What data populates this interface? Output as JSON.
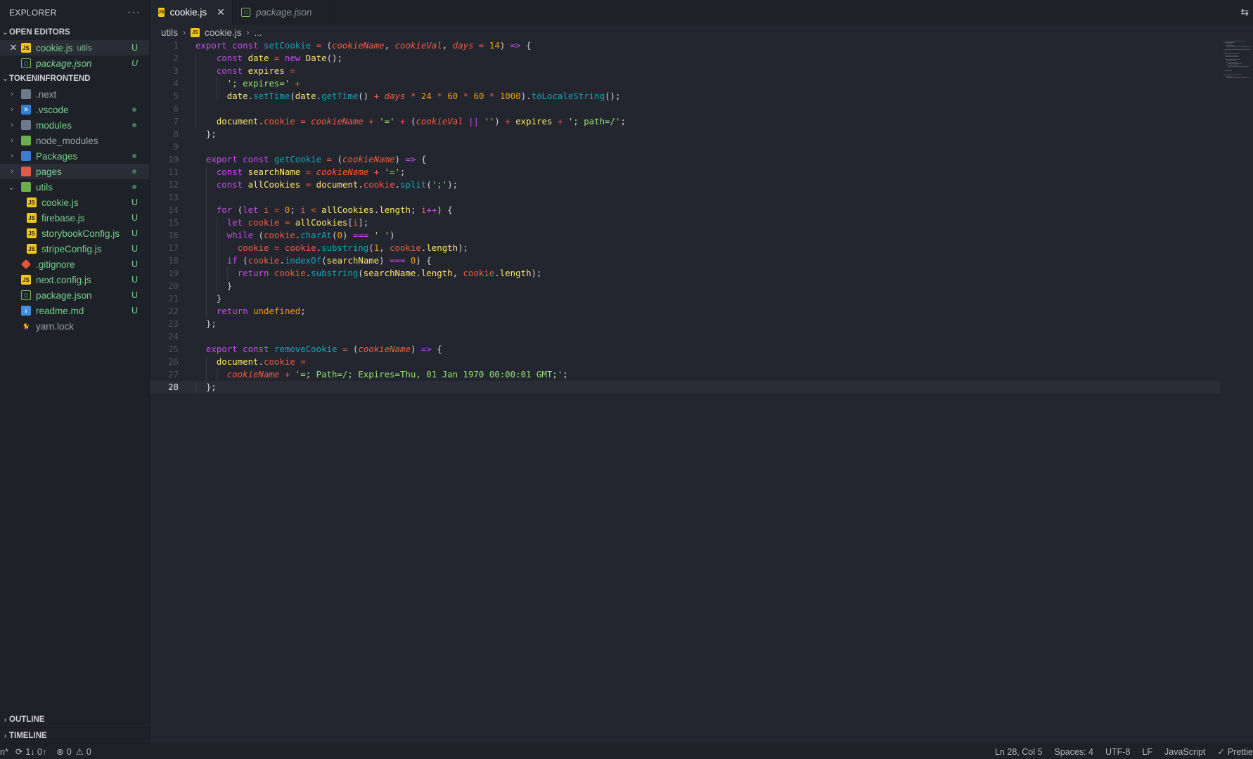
{
  "sidebar": {
    "title": "EXPLORER",
    "more_label": "···",
    "open_editors": {
      "title": "OPEN EDITORS",
      "items": [
        {
          "name": "cookie.js",
          "hint": "utils",
          "status": "U"
        },
        {
          "name": "package.json",
          "status": "U"
        }
      ]
    },
    "project": {
      "title": "TOKENINFRONTEND",
      "items": [
        {
          "name": ".next"
        },
        {
          "name": ".vscode"
        },
        {
          "name": "modules"
        },
        {
          "name": "node_modules"
        },
        {
          "name": "Packages"
        },
        {
          "name": "pages"
        },
        {
          "name": "utils"
        },
        {
          "name": "cookie.js",
          "status": "U"
        },
        {
          "name": "firebase.js",
          "status": "U"
        },
        {
          "name": "storybookConfig.js",
          "status": "U"
        },
        {
          "name": "stripeConfig.js",
          "status": "U"
        },
        {
          "name": ".gitignore",
          "status": "U"
        },
        {
          "name": "next.config.js",
          "status": "U"
        },
        {
          "name": "package.json",
          "status": "U"
        },
        {
          "name": "readme.md",
          "status": "U"
        },
        {
          "name": "yarn.lock"
        }
      ]
    },
    "outline_title": "OUTLINE",
    "timeline_title": "TIMELINE"
  },
  "tabs": [
    {
      "label": "cookie.js",
      "active": true
    },
    {
      "label": "package.json",
      "active": false
    }
  ],
  "breadcrumb": {
    "folder": "utils",
    "file": "cookie.js",
    "more": "..."
  },
  "editor": {
    "line_numbers": [
      "1",
      "2",
      "3",
      "4",
      "5",
      "6",
      "7",
      "8",
      "9",
      "10",
      "11",
      "12",
      "13",
      "14",
      "15",
      "16",
      "17",
      "18",
      "19",
      "20",
      "21",
      "22",
      "23",
      "24",
      "25",
      "26",
      "27",
      "28"
    ],
    "current_line": 28
  },
  "statusbar": {
    "branch": "n*",
    "sync": "1↓ 0↑",
    "errors": "0",
    "warnings": "0",
    "position": "Ln 28, Col 5",
    "spaces": "Spaces: 4",
    "encoding": "UTF-8",
    "eol": "LF",
    "language": "JavaScript",
    "formatter": "Prettie"
  },
  "colors": {
    "background": "#23262e",
    "sidebar": "#1e2128",
    "keyword": "#c74ded",
    "function": "#16a3b6",
    "param": "#ee5d43",
    "string": "#96e072",
    "number": "#f39c12",
    "variable": "#ffe66d",
    "untracked": "#77cf8d"
  },
  "icons": [
    "ellipsis-icon",
    "js-file-icon",
    "npm-package-icon",
    "folder-icon",
    "git-icon",
    "info-icon",
    "yarn-icon",
    "chevron-right-icon",
    "chevron-down-icon",
    "close-icon",
    "compare-icon",
    "sync-icon",
    "error-icon",
    "warning-icon",
    "check-icon"
  ]
}
